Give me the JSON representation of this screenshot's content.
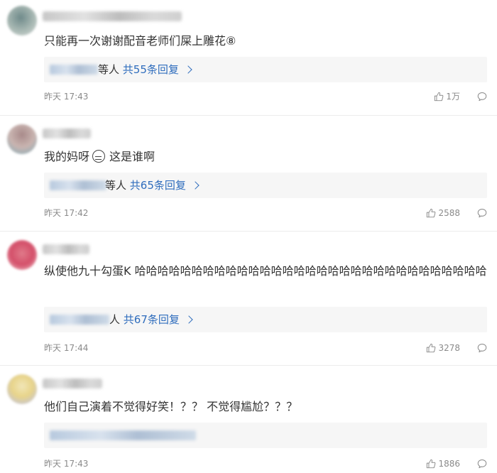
{
  "comments": [
    {
      "text": "只能再一次谢谢配音老师们屎上雕花⑧",
      "reply_suffix": "等人",
      "reply_count": "共55条回复",
      "time": "昨天 17:43",
      "likes": "1万"
    },
    {
      "text_before": "我的妈呀",
      "emoji": "grimace-emoji",
      "text_after": "这是谁啊",
      "reply_suffix": "等人",
      "reply_count": "共65条回复",
      "time": "昨天 17:42",
      "likes": "2588"
    },
    {
      "text": "纵使他九十勾蛋K 哈哈哈哈哈哈哈哈哈哈哈哈哈哈哈哈哈哈哈哈哈哈哈哈哈哈哈哈哈哈哈",
      "reply_suffix": "人",
      "reply_count": "共67条回复",
      "time": "昨天 17:44",
      "likes": "3278"
    },
    {
      "text": "他们自己演着不觉得好笑！？？ 不觉得尴尬？？？",
      "time": "昨天 17:43",
      "likes": "1886"
    }
  ],
  "icons": {
    "like": "thumbs-up-icon",
    "reply": "comment-bubble-icon",
    "more": "chevron-right-icon"
  },
  "colors": {
    "link": "#2f6dbd",
    "meta": "#8a8a8a",
    "reply_bg": "#f6f6f6"
  }
}
